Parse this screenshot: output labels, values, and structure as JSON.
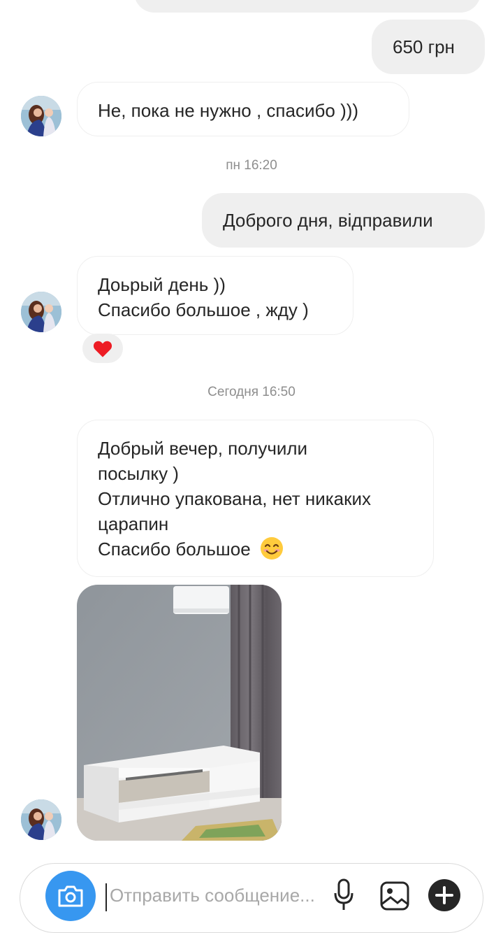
{
  "messages": {
    "outgoing_1": "650 грн",
    "incoming_1": "Не, пока не нужно , спасибо )))",
    "timestamp_1": "пн 16:20",
    "outgoing_2": "Доброго дня, відправили",
    "incoming_2": [
      "Доьрый день ))",
      "Спасибо большое , жду )"
    ],
    "reaction_2": "heart",
    "timestamp_2": "Сегодня 16:50",
    "incoming_3": [
      "Добрый вечер,  получили",
      "посылку )",
      "Отлично упакована, нет никаких",
      "царапин",
      "Спасибо большое"
    ],
    "incoming_3_emoji": "smiling-face-emoji"
  },
  "composer": {
    "placeholder": "Отправить сообщение...",
    "icons": [
      "camera-icon",
      "microphone-icon",
      "gallery-icon",
      "plus-icon"
    ]
  },
  "colors": {
    "outgoing_bubble": "#efefef",
    "incoming_border": "#efefef",
    "timestamp": "#8e8e8e",
    "camera_button": "#3797f0",
    "heart": "#ed1c24"
  }
}
